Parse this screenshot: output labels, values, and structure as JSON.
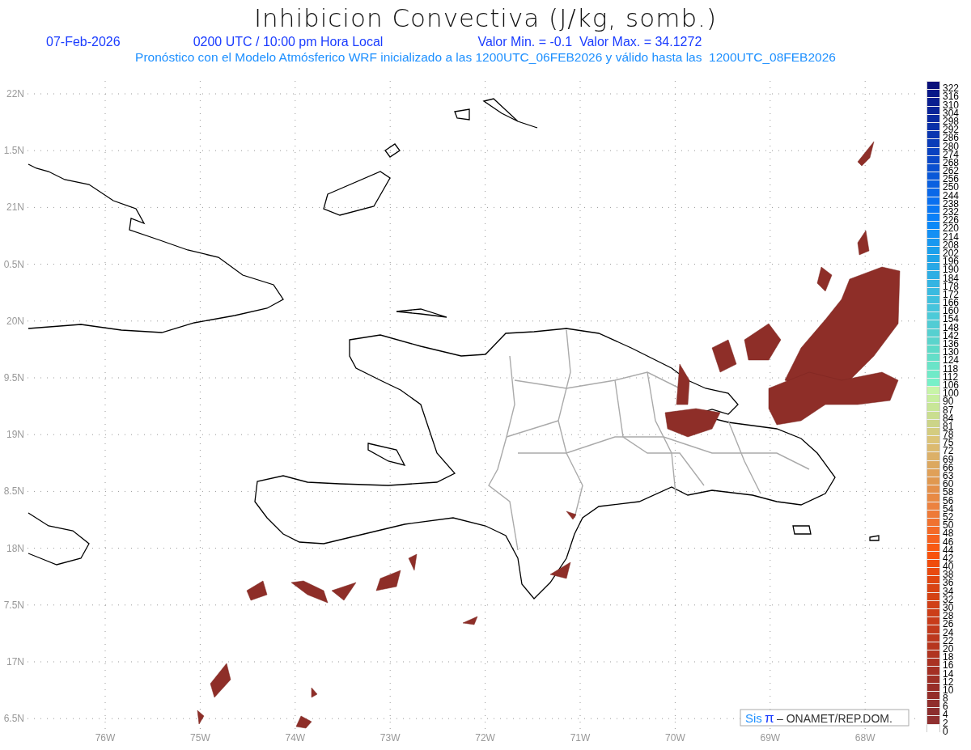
{
  "title": "Inhibicion Convectiva (J/kg, somb.)",
  "info": {
    "date": "07-Feb-2026",
    "time": "0200 UTC / 10:00 pm Hora Local",
    "range": "Valor Min. = -0.1  Valor Max. = 34.1272"
  },
  "subtitle": "Pronóstico con el Modelo Atmósferico WRF inicializado a las 1200UTC_06FEB2026 y válido hasta las  1200UTC_08FEB2026",
  "map": {
    "lat_labels": [
      "22N",
      "1.5N",
      "21N",
      "0.5N",
      "20N",
      "9.5N",
      "19N",
      "8.5N",
      "18N",
      "7.5N",
      "17N",
      "6.5N"
    ],
    "lon_labels": [
      "76W",
      "75W",
      "74W",
      "73W",
      "72W",
      "71W",
      "70W",
      "69W",
      "68W"
    ],
    "credit": {
      "logo": "Sis",
      "symbol": "π",
      "text": "– ONAMET/REP.DOM."
    }
  },
  "legend": [
    {
      "label": "322",
      "color": "#08107a"
    },
    {
      "label": "316",
      "color": "#081888"
    },
    {
      "label": "310",
      "color": "#0a1e90"
    },
    {
      "label": "304",
      "color": "#0a2498"
    },
    {
      "label": "298",
      "color": "#0a2aa0"
    },
    {
      "label": "292",
      "color": "#0a30a8"
    },
    {
      "label": "286",
      "color": "#0a36b0"
    },
    {
      "label": "280",
      "color": "#0a3cb8"
    },
    {
      "label": "274",
      "color": "#0a42c0"
    },
    {
      "label": "268",
      "color": "#0a48c8"
    },
    {
      "label": "262",
      "color": "#0a50d0"
    },
    {
      "label": "256",
      "color": "#0a58d8"
    },
    {
      "label": "250",
      "color": "#0a60e0"
    },
    {
      "label": "244",
      "color": "#0a68e8"
    },
    {
      "label": "238",
      "color": "#0a70f0"
    },
    {
      "label": "232",
      "color": "#0a78f4"
    },
    {
      "label": "226",
      "color": "#0a80f8"
    },
    {
      "label": "220",
      "color": "#0a88f8"
    },
    {
      "label": "214",
      "color": "#1490f4"
    },
    {
      "label": "208",
      "color": "#1898f0"
    },
    {
      "label": "202",
      "color": "#1ca0ec"
    },
    {
      "label": "196",
      "color": "#20a4e8"
    },
    {
      "label": "190",
      "color": "#28a8e6"
    },
    {
      "label": "184",
      "color": "#2eaee4"
    },
    {
      "label": "178",
      "color": "#34b4e2"
    },
    {
      "label": "172",
      "color": "#3abae0"
    },
    {
      "label": "166",
      "color": "#40c0de"
    },
    {
      "label": "160",
      "color": "#46c4dc"
    },
    {
      "label": "154",
      "color": "#4ccad8"
    },
    {
      "label": "148",
      "color": "#52ccd4"
    },
    {
      "label": "142",
      "color": "#56d0d0"
    },
    {
      "label": "136",
      "color": "#5ad4cc"
    },
    {
      "label": "130",
      "color": "#5edac8"
    },
    {
      "label": "124",
      "color": "#64dec8"
    },
    {
      "label": "118",
      "color": "#6ae4c8"
    },
    {
      "label": "112",
      "color": "#70eac8"
    },
    {
      "label": "106",
      "color": "#78f0c8"
    },
    {
      "label": "100",
      "color": "#c8f4a8"
    },
    {
      "label": "90",
      "color": "#c8eea0"
    },
    {
      "label": "87",
      "color": "#c8e698"
    },
    {
      "label": "84",
      "color": "#cade90"
    },
    {
      "label": "81",
      "color": "#ccd488"
    },
    {
      "label": "78",
      "color": "#d4cc80"
    },
    {
      "label": "75",
      "color": "#dcc478"
    },
    {
      "label": "72",
      "color": "#dcba70"
    },
    {
      "label": "69",
      "color": "#dcb068"
    },
    {
      "label": "66",
      "color": "#dca860"
    },
    {
      "label": "63",
      "color": "#e0a058"
    },
    {
      "label": "60",
      "color": "#e09850"
    },
    {
      "label": "58",
      "color": "#e4904a"
    },
    {
      "label": "56",
      "color": "#e88a44"
    },
    {
      "label": "54",
      "color": "#ec8240"
    },
    {
      "label": "52",
      "color": "#ee7a38"
    },
    {
      "label": "50",
      "color": "#f07230"
    },
    {
      "label": "48",
      "color": "#f46a28"
    },
    {
      "label": "46",
      "color": "#f66220"
    },
    {
      "label": "44",
      "color": "#f85a14"
    },
    {
      "label": "42",
      "color": "#f8520c"
    },
    {
      "label": "40",
      "color": "#f04c0c"
    },
    {
      "label": "38",
      "color": "#e84a10"
    },
    {
      "label": "36",
      "color": "#e04610"
    },
    {
      "label": "34",
      "color": "#d84414"
    },
    {
      "label": "32",
      "color": "#d44214"
    },
    {
      "label": "30",
      "color": "#d04018"
    },
    {
      "label": "28",
      "color": "#cc3e18"
    },
    {
      "label": "26",
      "color": "#c83c1a"
    },
    {
      "label": "24",
      "color": "#c23a1c"
    },
    {
      "label": "22",
      "color": "#bc381e"
    },
    {
      "label": "20",
      "color": "#b6361e"
    },
    {
      "label": "18",
      "color": "#b03420"
    },
    {
      "label": "16",
      "color": "#aa3222"
    },
    {
      "label": "14",
      "color": "#a43024"
    },
    {
      "label": "12",
      "color": "#9e3026"
    },
    {
      "label": "10",
      "color": "#982e28"
    },
    {
      "label": "8",
      "color": "#942e2a"
    },
    {
      "label": "6",
      "color": "#902e2c"
    },
    {
      "label": "4",
      "color": "#8c2e2e"
    },
    {
      "label": "2",
      "color": "#903030"
    },
    {
      "label": "0",
      "color": "#ffffff"
    }
  ]
}
